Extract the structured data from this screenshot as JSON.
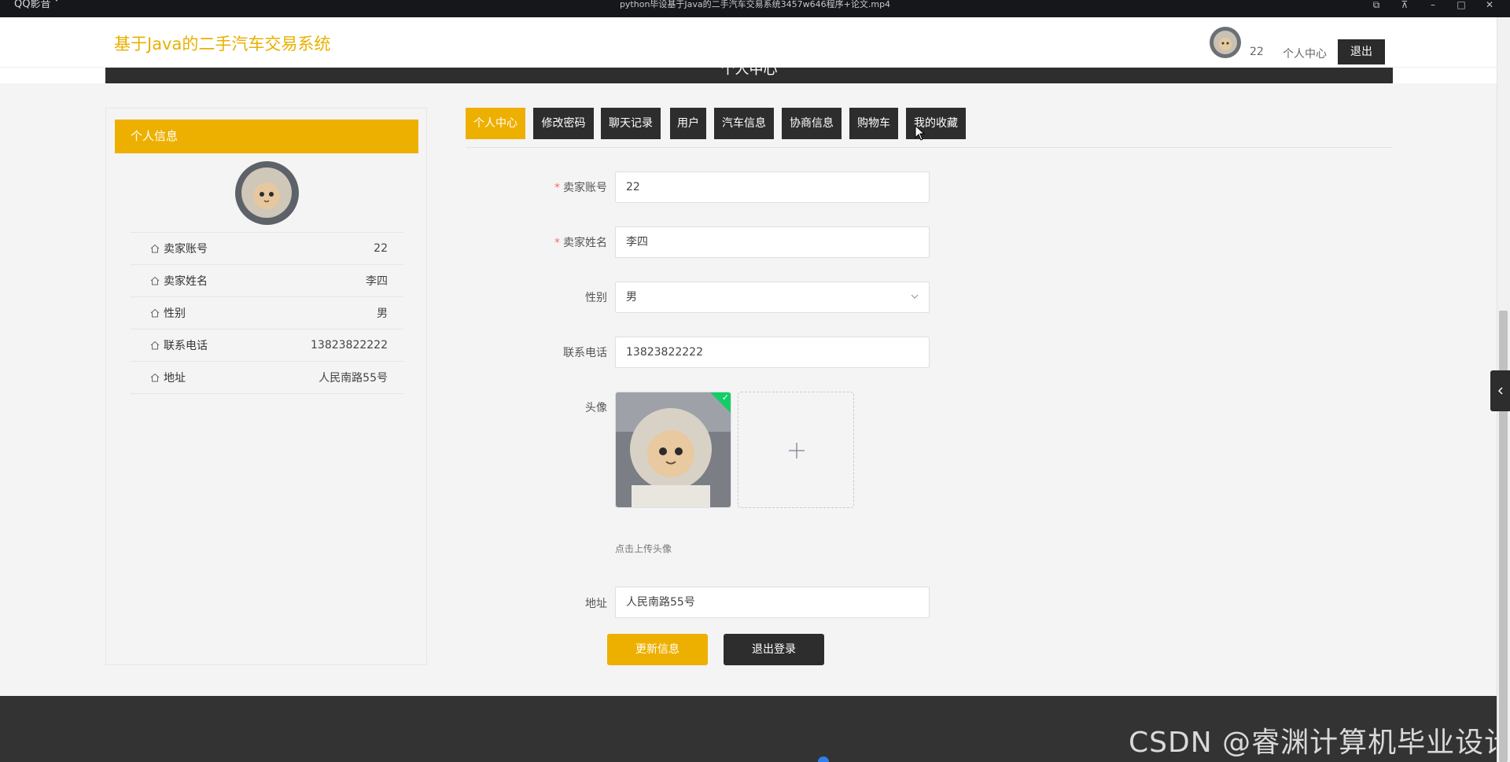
{
  "player": {
    "app_name": "QQ影音 ˅",
    "video_title": "python毕设基于Java的二手汽车交易系统3457w646程序+论文.mp4"
  },
  "header": {
    "logo": "基于Java的二手汽车交易系统",
    "username": "22",
    "center_link": "个人中心",
    "logout": "退出"
  },
  "title_band": "个人中心",
  "profile": {
    "panel_title": "个人信息",
    "rows": [
      {
        "label": "卖家账号",
        "value": "22"
      },
      {
        "label": "卖家姓名",
        "value": "李四"
      },
      {
        "label": "性别",
        "value": "男"
      },
      {
        "label": "联系电话",
        "value": "13823822222"
      },
      {
        "label": "地址",
        "value": "人民南路55号"
      }
    ]
  },
  "tabs": [
    {
      "label": "个人中心",
      "active": true
    },
    {
      "label": "修改密码",
      "active": false
    },
    {
      "label": "聊天记录",
      "active": false
    },
    {
      "label": "用户",
      "active": false
    },
    {
      "label": "汽车信息",
      "active": false
    },
    {
      "label": "协商信息",
      "active": false
    },
    {
      "label": "购物车",
      "active": false
    },
    {
      "label": "我的收藏",
      "active": false
    }
  ],
  "form": {
    "account_label": "卖家账号",
    "account_value": "22",
    "name_label": "卖家姓名",
    "name_value": "李四",
    "gender_label": "性别",
    "gender_value": "男",
    "phone_label": "联系电话",
    "phone_value": "13823822222",
    "avatar_label": "头像",
    "upload_hint": "点击上传头像",
    "address_label": "地址",
    "address_value": "人民南路55号",
    "update_button": "更新信息",
    "logout_button": "退出登录"
  },
  "watermark": "CSDN @睿渊计算机毕业设计",
  "colors": {
    "accent": "#eeb000",
    "dark": "#2d2d2d",
    "success": "#13ce66"
  }
}
